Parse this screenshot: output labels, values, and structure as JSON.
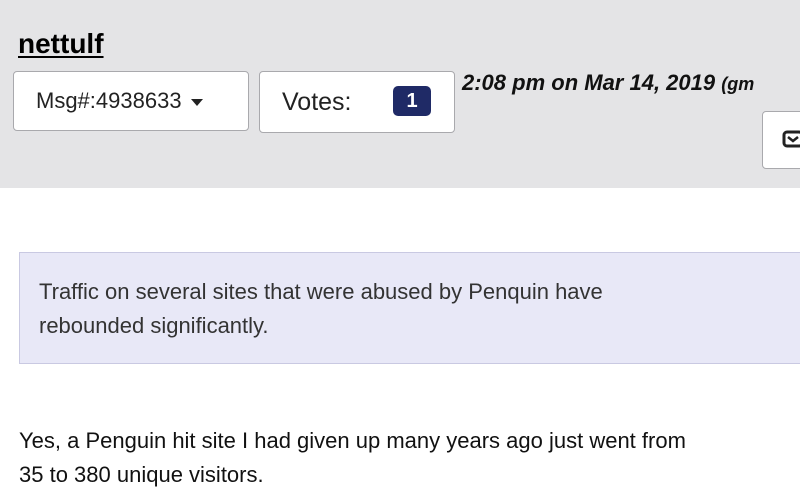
{
  "post": {
    "username": "nettulf",
    "msg_label": "Msg#:4938633",
    "votes_label": "Votes:",
    "votes_count": "1",
    "timestamp": "2:08 pm on Mar 14, 2019",
    "timezone": "(gm"
  },
  "quote": {
    "line1": "Traffic on several sites that were abused by Penquin have",
    "line2": "rebounded significantly."
  },
  "body": {
    "line1": "Yes, a Penguin hit site I had given up many years ago just went from",
    "line2": "35 to 380 unique visitors."
  },
  "colors": {
    "header_bg": "#e4e4e6",
    "quote_bg": "#e8e8f7",
    "badge_bg": "#1f2a66"
  },
  "icons": {
    "msg_caret": "chevron-down-icon",
    "edge_button": "message-icon"
  }
}
